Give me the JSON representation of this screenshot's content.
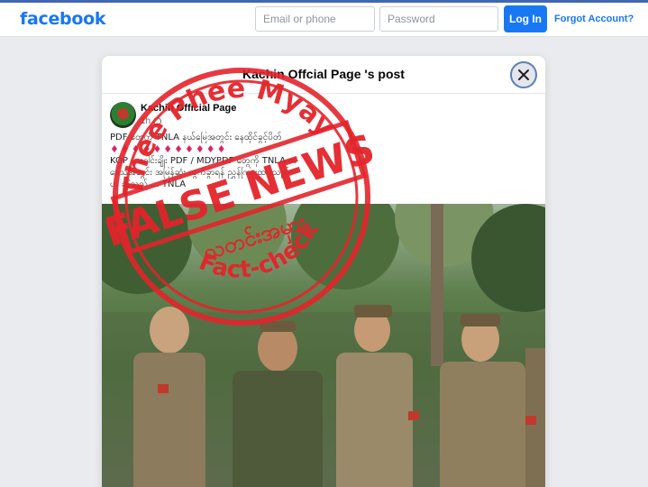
{
  "brand": {
    "logo": "facebook"
  },
  "login": {
    "email_placeholder": "Email or phone",
    "password_placeholder": "Password",
    "login_label": "Log In",
    "forgot_label": "Forgot Account?"
  },
  "modal": {
    "title": "Kachin Offcial Page 's post",
    "close_icon": "close-icon"
  },
  "post": {
    "page_name": "Kachin Official Page",
    "time": "1h",
    "lines": [
      "PDF တွေကို TNLA နယ်မြေအတွင်း နေထိုင်ခွင့်ပိတ်",
      "♦♦♦♦♦♦♦♦♦♦♦",
      "",
      "KOP မှ ခေါင်းချိုး PDF / MDYPDF တွေကို TNLA က",
      "ဒေသအတွင်း အမြန်ဆုံး ထွက်ခွာရန် ညွှန်ကြားထားသည်",
      "ဟု ဆိုသည် ... TNLA"
    ]
  },
  "stamp": {
    "top_arc": "Thee Phee Myay",
    "center": "FALSE NEWS",
    "burmese": "သတင်းအမှား",
    "bottom_arc": "Fact-check",
    "color": "#e3242b"
  },
  "colors": {
    "accent": "#1877f2",
    "header_border": "#4267b2",
    "page_bg": "#e9ebee"
  }
}
